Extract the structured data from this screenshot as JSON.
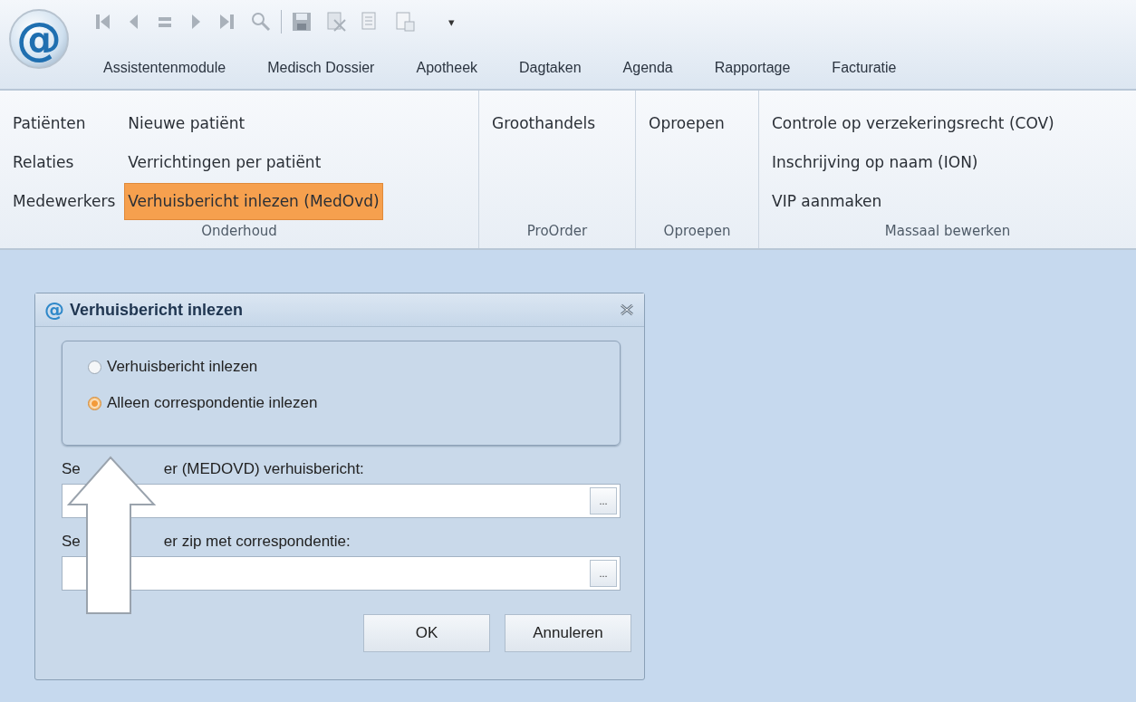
{
  "app_button": {
    "symbol": "@"
  },
  "quick_access": {
    "menu_glyph": "▾"
  },
  "tabs": [
    {
      "label": "Assistentenmodule"
    },
    {
      "label": "Medisch Dossier"
    },
    {
      "label": "Apotheek"
    },
    {
      "label": "Dagtaken"
    },
    {
      "label": "Agenda"
    },
    {
      "label": "Rapportage"
    },
    {
      "label": "Facturatie"
    }
  ],
  "ribbon_groups": [
    {
      "label": "Onderhoud",
      "columns": [
        [
          {
            "label": "Patiënten",
            "selected": false
          },
          {
            "label": "Relaties",
            "selected": false
          },
          {
            "label": "Medewerkers",
            "selected": false
          }
        ],
        [
          {
            "label": "Nieuwe patiënt",
            "selected": false
          },
          {
            "label": "Verrichtingen per patiënt",
            "selected": false
          },
          {
            "label": "Verhuisbericht inlezen (MedOvd)",
            "selected": true
          }
        ]
      ]
    },
    {
      "label": "ProOrder",
      "columns": [
        [
          {
            "label": "Groothandels",
            "selected": false
          }
        ]
      ]
    },
    {
      "label": "Oproepen",
      "columns": [
        [
          {
            "label": "Oproepen",
            "selected": false
          }
        ]
      ]
    },
    {
      "label": "Massaal bewerken",
      "columns": [
        [
          {
            "label": "Controle op verzekeringsrecht (COV)",
            "selected": false
          },
          {
            "label": "Inschrijving op naam (ION)",
            "selected": false
          },
          {
            "label": "VIP aanmaken",
            "selected": false
          }
        ]
      ]
    }
  ],
  "dialog": {
    "icon_symbol": "@",
    "title": "Verhuisbericht inlezen",
    "options": [
      {
        "label": "Verhuisbericht inlezen",
        "selected": false
      },
      {
        "label": "Alleen correspondentie inlezen",
        "selected": true
      }
    ],
    "fields": [
      {
        "label_parts": [
          "Se",
          "er (MEDOVD) verhuisbericht:"
        ],
        "browse_label": "..."
      },
      {
        "label_parts": [
          "Se",
          "er zip met correspondentie:"
        ],
        "browse_label": "..."
      }
    ],
    "buttons": [
      "OK",
      "Annuleren"
    ]
  }
}
